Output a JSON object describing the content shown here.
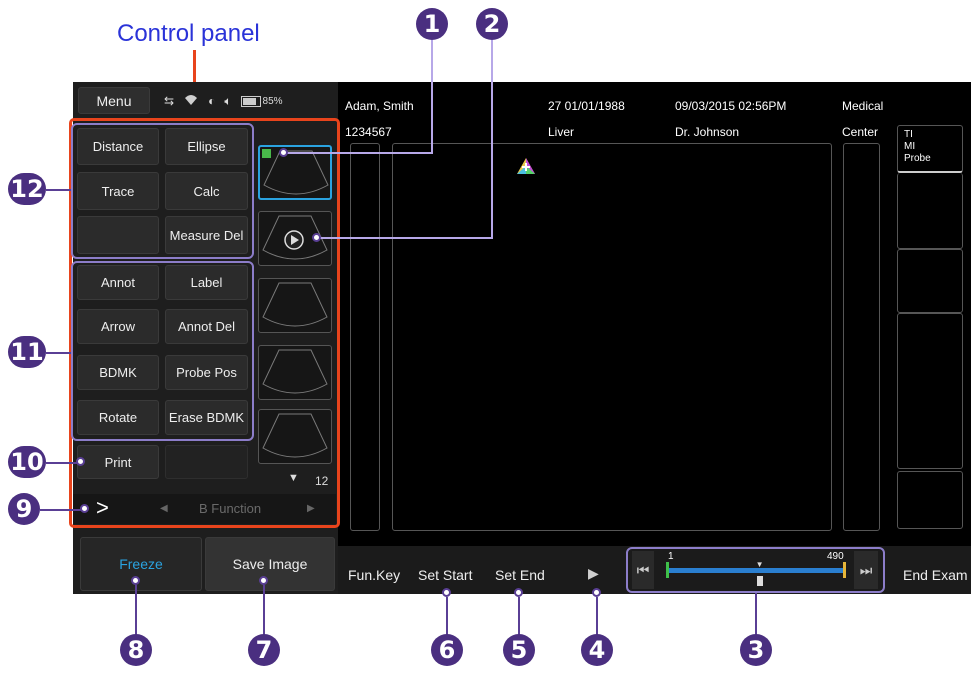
{
  "control_panel_title": "Control panel",
  "header": {
    "menu_label": "Menu",
    "battery": "85%",
    "patient_name": "Adam, Smith",
    "patient_id": "1234567",
    "age_birth": "27 01/01/1988",
    "exam_type": "Liver",
    "datetime": "09/03/2015 02:56PM",
    "doctor": "Dr. Johnson",
    "facility_line1": "Medical",
    "facility_line2": "Center"
  },
  "measure_buttons": [
    "Distance",
    "Ellipse",
    "Trace",
    "Calc",
    "",
    "Measure Del"
  ],
  "annot_buttons": [
    "Annot",
    "Label",
    "Arrow",
    "Annot Del",
    "BDMK",
    "Probe Pos",
    "Rotate",
    "Erase BDMK"
  ],
  "print_label": "Print",
  "thumbnails": {
    "count": "12"
  },
  "function_bar": {
    "label": "B Function",
    "next_symbol": ">"
  },
  "freeze_label": "Freeze",
  "save_image_label": "Save Image",
  "bottom_bar": {
    "fun_key": "Fun.Key",
    "set_start": "Set Start",
    "set_end": "Set End",
    "end_exam": "End Exam"
  },
  "cine": {
    "start_frame": "1",
    "end_frame": "490",
    "position": 0.52
  },
  "right_panel": {
    "line1": "TI",
    "line2": "MI",
    "line3": "Probe"
  },
  "callouts": {
    "c1": "1",
    "c2": "2",
    "c3": "3",
    "c4": "4",
    "c5": "5",
    "c6": "6",
    "c7": "7",
    "c8": "8",
    "c9": "9",
    "c10": "10",
    "c11": "11",
    "c12": "12"
  },
  "colors": {
    "accent_red": "#e8441c",
    "callout_purple": "#4a2f80",
    "title_blue": "#2a33d8",
    "freeze_blue": "#2aa3e0"
  }
}
